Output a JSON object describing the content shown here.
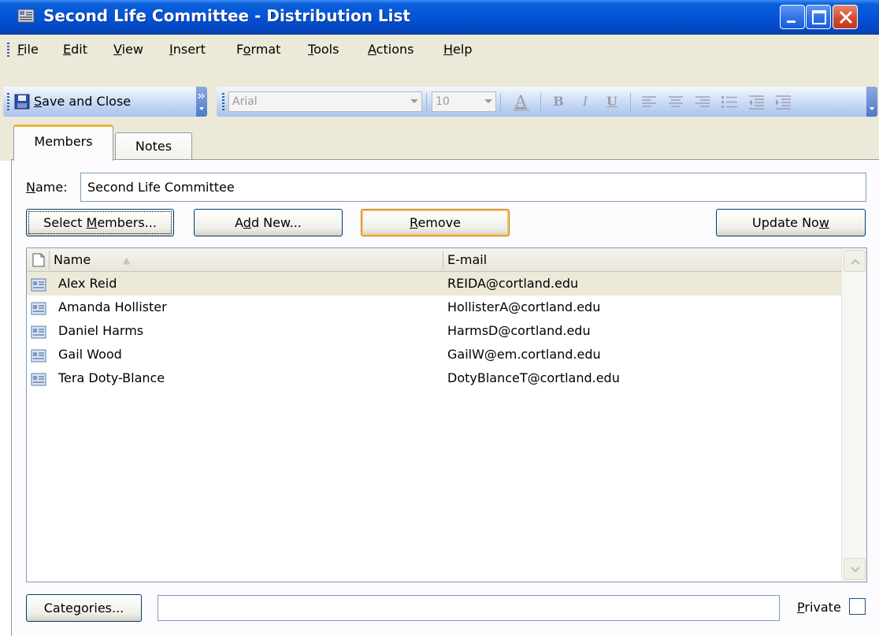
{
  "window": {
    "title": "Second Life Committee - Distribution List"
  },
  "menu": {
    "items": [
      "File",
      "Edit",
      "View",
      "Insert",
      "Format",
      "Tools",
      "Actions",
      "Help"
    ]
  },
  "toolbar": {
    "save_close_label": "Save and Close",
    "font_name": "Arial",
    "font_size": "10"
  },
  "tabs": [
    {
      "label": "Members",
      "active": true
    },
    {
      "label": "Notes",
      "active": false
    }
  ],
  "form": {
    "name_label": "Name:",
    "name_value": "Second Life Committee",
    "select_members_label": "Select Members...",
    "add_new_label": "Add New...",
    "remove_label": "Remove",
    "update_now_label": "Update Now",
    "categories_label": "Categories...",
    "categories_value": "",
    "private_label": "Private",
    "private_checked": false
  },
  "members_table": {
    "columns": [
      "Name",
      "E-mail"
    ],
    "rows": [
      {
        "name": "Alex Reid",
        "email": "REIDA@cortland.edu"
      },
      {
        "name": "Amanda Hollister",
        "email": "HollisterA@cortland.edu"
      },
      {
        "name": "Daniel Harms",
        "email": "HarmsD@cortland.edu"
      },
      {
        "name": "Gail Wood",
        "email": "GailW@em.cortland.edu"
      },
      {
        "name": "Tera Doty-Blance",
        "email": "DotyBlanceT@cortland.edu"
      }
    ]
  },
  "colors": {
    "titlebar": "#0453d6",
    "chrome": "#ece9d8",
    "accent_tab": "#f3b23c",
    "selected_row": "#ece9d8"
  }
}
